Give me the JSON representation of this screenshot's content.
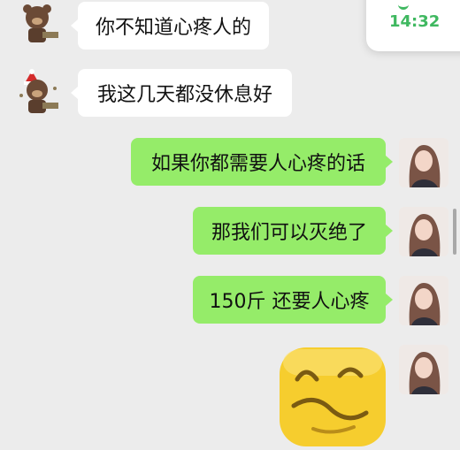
{
  "messages": [
    {
      "side": "left",
      "text": "你不知道心疼人的"
    },
    {
      "side": "left",
      "text": "我这几天都没休息好"
    },
    {
      "side": "right",
      "text": "如果你都需要人心疼的话"
    },
    {
      "side": "right",
      "text": "那我们可以灭绝了"
    },
    {
      "side": "right",
      "text": "150斤 还要人心疼"
    },
    {
      "side": "right",
      "sticker": "yellow-smirk-emoji-sticker"
    }
  ],
  "call_card": {
    "time": "14:32",
    "icon": "phone-icon"
  },
  "colors": {
    "background": "#ececec",
    "left_bubble": "#ffffff",
    "right_bubble": "#95ec69",
    "accent": "#3fb860"
  }
}
